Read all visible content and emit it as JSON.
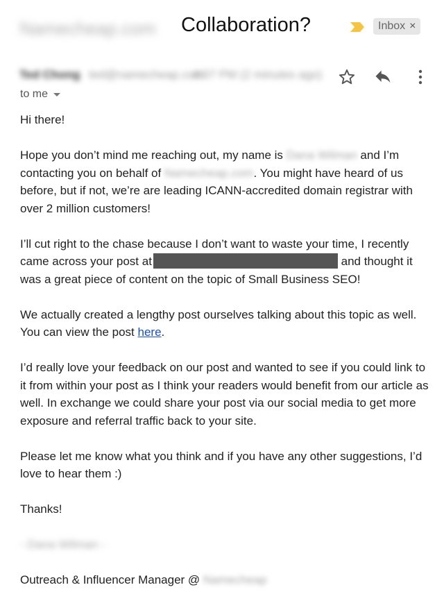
{
  "header": {
    "subject_prefix_blurred": "Namecheap.com",
    "subject": "Collaboration?",
    "label": "Inbox",
    "label_close": "×",
    "importance_color": "#f5c542"
  },
  "sender": {
    "name_blurred": "Ted Chong",
    "email_blurred": "ted@namecheap.com",
    "time_blurred": "4:07 PM (2 minutes ago)",
    "recipient": "to me"
  },
  "icons": {
    "star": "star-icon",
    "reply": "reply-icon",
    "more": "more-vert-icon"
  },
  "message": {
    "greeting": "Hi there!",
    "p1_a": "Hope you don’t mind me reaching out, my name is ",
    "p1_name_blurred": "Dana Wilman",
    "p1_b": " and I’m contacting you on behalf of ",
    "p1_company_blurred": "Namecheap.com",
    "p1_c": ". You might have heard of us before, but if not, we’re are leading ICANN-accredited domain registrar with over 2 million customers!",
    "p2_a": "I’ll cut right to the chase because I don’t want to waste your time, I recently came across your post at",
    "p2_b": " and thought it was a great piece of content on the topic of Small Business SEO!",
    "p3_a": "We actually created a lengthy post ourselves talking about this topic as well. You can view the post ",
    "p3_link": "here",
    "p3_b": ".",
    "p4": "I’d really love your feedback on our post and wanted to see if you could link to it from within your post as I think your readers would benefit from our article as well. In exchange we could share your post via our social media to get more exposure and referral traffic back to your site.",
    "p5": "Please let me know what you think and if you have any other suggestions, I’d love to hear them :)",
    "thanks": "Thanks!",
    "signature_name_blurred": "- Dana Wilman -",
    "signature_title": "Outreach & Influencer Manager @ ",
    "signature_company_blurred": "Namecheap",
    "link_color": "#1a4fc9",
    "redaction_color": "#555555"
  }
}
